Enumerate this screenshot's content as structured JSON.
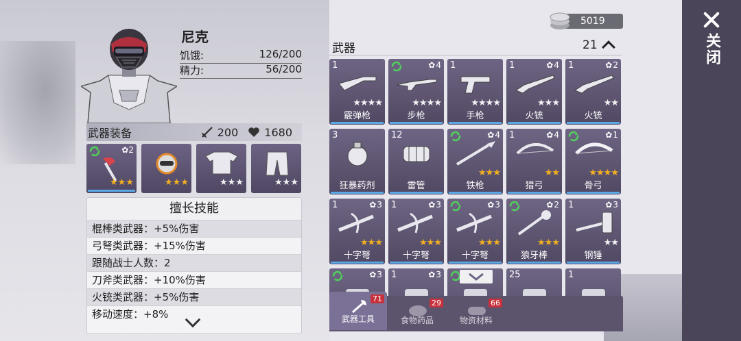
{
  "player": {
    "name": "尼克",
    "hunger_label": "饥饿:",
    "hunger_value": "126/200",
    "energy_label": "精力:",
    "energy_value": "56/200"
  },
  "equipment": {
    "title": "武器装备",
    "attack": "200",
    "health": "1680",
    "slots": [
      {
        "icon": "axe-icon",
        "level": "2",
        "stars": 3,
        "gold": true
      },
      {
        "icon": "helmet-icon",
        "stars": 3,
        "gold": true
      },
      {
        "icon": "armor-icon",
        "stars": 3,
        "gold": false
      },
      {
        "icon": "pants-icon",
        "stars": 3,
        "gold": false
      }
    ]
  },
  "skills": {
    "title": "擅长技能",
    "items": [
      "棍棒类武器：+5%伤害",
      "弓弩类武器：+15%伤害",
      "跟随战士人数：2",
      "刀斧类武器：+10%伤害",
      "火铳类武器：+5%伤害",
      "移动速度：+8%"
    ]
  },
  "currency": {
    "value": "5019"
  },
  "inventory": {
    "title": "武器",
    "count": "21",
    "items": [
      {
        "qty": "1",
        "lvl": "",
        "name": "霰弹枪",
        "stars": 4,
        "gold": false,
        "recycle": false,
        "icon": "shotgun-icon"
      },
      {
        "qty": "",
        "lvl": "4",
        "name": "步枪",
        "stars": 4,
        "gold": false,
        "recycle": true,
        "icon": "rifle-icon"
      },
      {
        "qty": "1",
        "lvl": "",
        "name": "手枪",
        "stars": 4,
        "gold": false,
        "recycle": false,
        "icon": "pistol-icon"
      },
      {
        "qty": "1",
        "lvl": "4",
        "name": "火铳",
        "stars": 3,
        "gold": false,
        "recycle": false,
        "icon": "musket-icon"
      },
      {
        "qty": "1",
        "lvl": "2",
        "name": "火铳",
        "stars": 2,
        "gold": false,
        "recycle": false,
        "icon": "musket-icon"
      },
      {
        "qty": "3",
        "lvl": "",
        "name": "狂暴药剂",
        "stars": 0,
        "gold": false,
        "recycle": false,
        "icon": "potion-icon"
      },
      {
        "qty": "12",
        "lvl": "",
        "name": "雷管",
        "stars": 0,
        "gold": false,
        "recycle": false,
        "icon": "dynamite-icon"
      },
      {
        "qty": "",
        "lvl": "4",
        "name": "铁枪",
        "stars": 3,
        "gold": true,
        "recycle": true,
        "icon": "spear-icon"
      },
      {
        "qty": "1",
        "lvl": "4",
        "name": "猎弓",
        "stars": 2,
        "gold": true,
        "recycle": false,
        "icon": "bow-icon"
      },
      {
        "qty": "",
        "lvl": "1",
        "name": "骨弓",
        "stars": 4,
        "gold": true,
        "recycle": true,
        "icon": "bone-bow-icon"
      },
      {
        "qty": "1",
        "lvl": "3",
        "name": "十字弩",
        "stars": 3,
        "gold": true,
        "recycle": false,
        "icon": "crossbow-icon"
      },
      {
        "qty": "1",
        "lvl": "3",
        "name": "十字弩",
        "stars": 3,
        "gold": true,
        "recycle": false,
        "icon": "crossbow-icon"
      },
      {
        "qty": "",
        "lvl": "3",
        "name": "十字弩",
        "stars": 3,
        "gold": true,
        "recycle": true,
        "icon": "crossbow-icon"
      },
      {
        "qty": "",
        "lvl": "2",
        "name": "狼牙棒",
        "stars": 3,
        "gold": true,
        "recycle": true,
        "icon": "mace-icon"
      },
      {
        "qty": "1",
        "lvl": "3",
        "name": "钢锤",
        "stars": 2,
        "gold": false,
        "recycle": false,
        "icon": "hammer-icon"
      },
      {
        "qty": "",
        "lvl": "3",
        "name": "",
        "stars": 0,
        "gold": false,
        "recycle": true,
        "icon": "item-icon"
      },
      {
        "qty": "1",
        "lvl": "3",
        "name": "",
        "stars": 0,
        "gold": false,
        "recycle": false,
        "icon": "item-icon"
      },
      {
        "qty": "",
        "lvl": "",
        "name": "",
        "stars": 0,
        "gold": false,
        "recycle": true,
        "icon": "item-icon"
      },
      {
        "qty": "25",
        "lvl": "",
        "name": "",
        "stars": 0,
        "gold": false,
        "recycle": false,
        "icon": "item-icon"
      },
      {
        "qty": "1",
        "lvl": "",
        "name": "",
        "stars": 0,
        "gold": false,
        "recycle": false,
        "icon": "item-icon"
      }
    ]
  },
  "tabs": [
    {
      "label": "武器工具",
      "badge": "71",
      "active": true
    },
    {
      "label": "食物药品",
      "badge": "29",
      "active": false
    },
    {
      "label": "物资材料",
      "badge": "66",
      "active": false
    }
  ],
  "close_label": "关闭"
}
